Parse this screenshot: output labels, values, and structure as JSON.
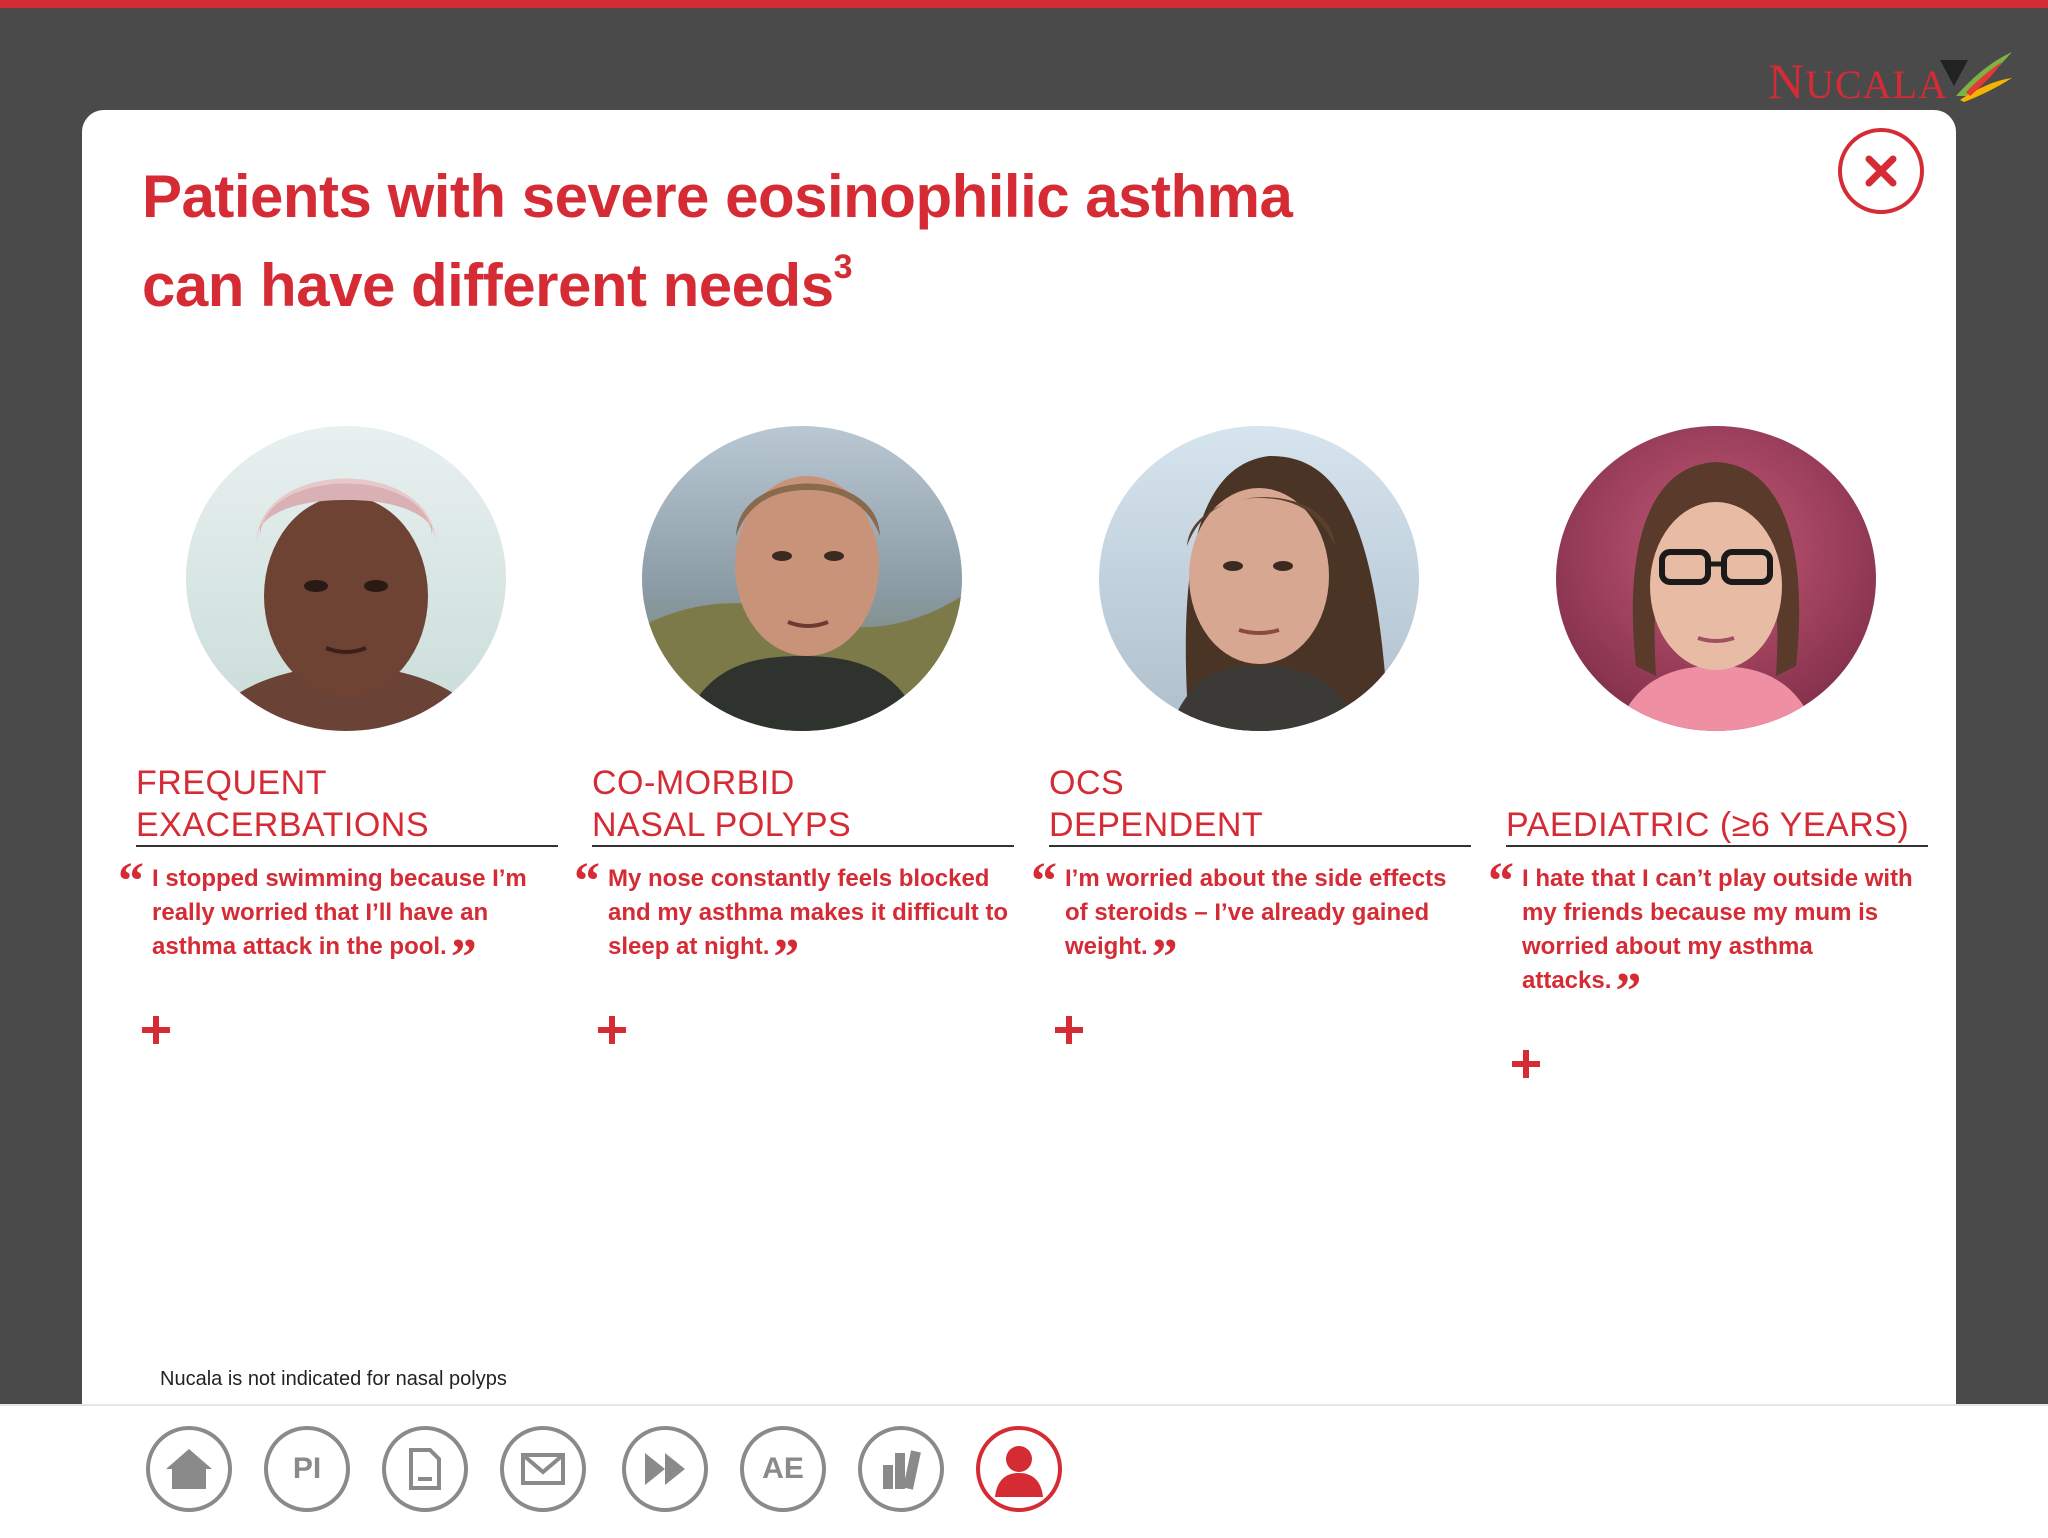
{
  "brand": {
    "logo_text": "NUCALA",
    "accent_color": "#d52b35"
  },
  "modal": {
    "title_line1": "Patients with severe eosinophilic asthma",
    "title_line2": "can have different needs",
    "title_superscript": "3",
    "close_icon": "close-icon"
  },
  "cards": [
    {
      "category_line1": "FREQUENT",
      "category_line2": "EXACERBATIONS",
      "quote": "I stopped swimming because I’m really worried that I’ll have an asthma attack in the pool.",
      "expand_icon": "plus-icon"
    },
    {
      "category_line1": "CO-MORBID",
      "category_line2": "NASAL POLYPS",
      "quote": "My nose constantly feels blocked and my asthma makes it difficult to sleep at night.",
      "expand_icon": "plus-icon"
    },
    {
      "category_line1": "OCS",
      "category_line2": "DEPENDENT",
      "quote": "I’m worried about the side effects of steroids – I’ve already gained weight.",
      "expand_icon": "plus-icon"
    },
    {
      "category_line1": "",
      "category_line2": "PAEDIATRIC (≥6 YEARS)",
      "quote": "I hate that I can’t play outside with my friends because my mum is worried about my asthma attacks.",
      "expand_icon": "plus-icon"
    }
  ],
  "quote_marks": {
    "open": "“",
    "close": "”"
  },
  "footnote": "Nucala is not indicated for nasal polyps",
  "nav": {
    "home_icon": "home-icon",
    "pi_label": "PI",
    "document_icon": "document-icon",
    "email_icon": "email-icon",
    "fast_forward_icon": "fast-forward-icon",
    "ae_label": "AE",
    "library_icon": "library-icon",
    "profile_icon": "profile-icon"
  }
}
